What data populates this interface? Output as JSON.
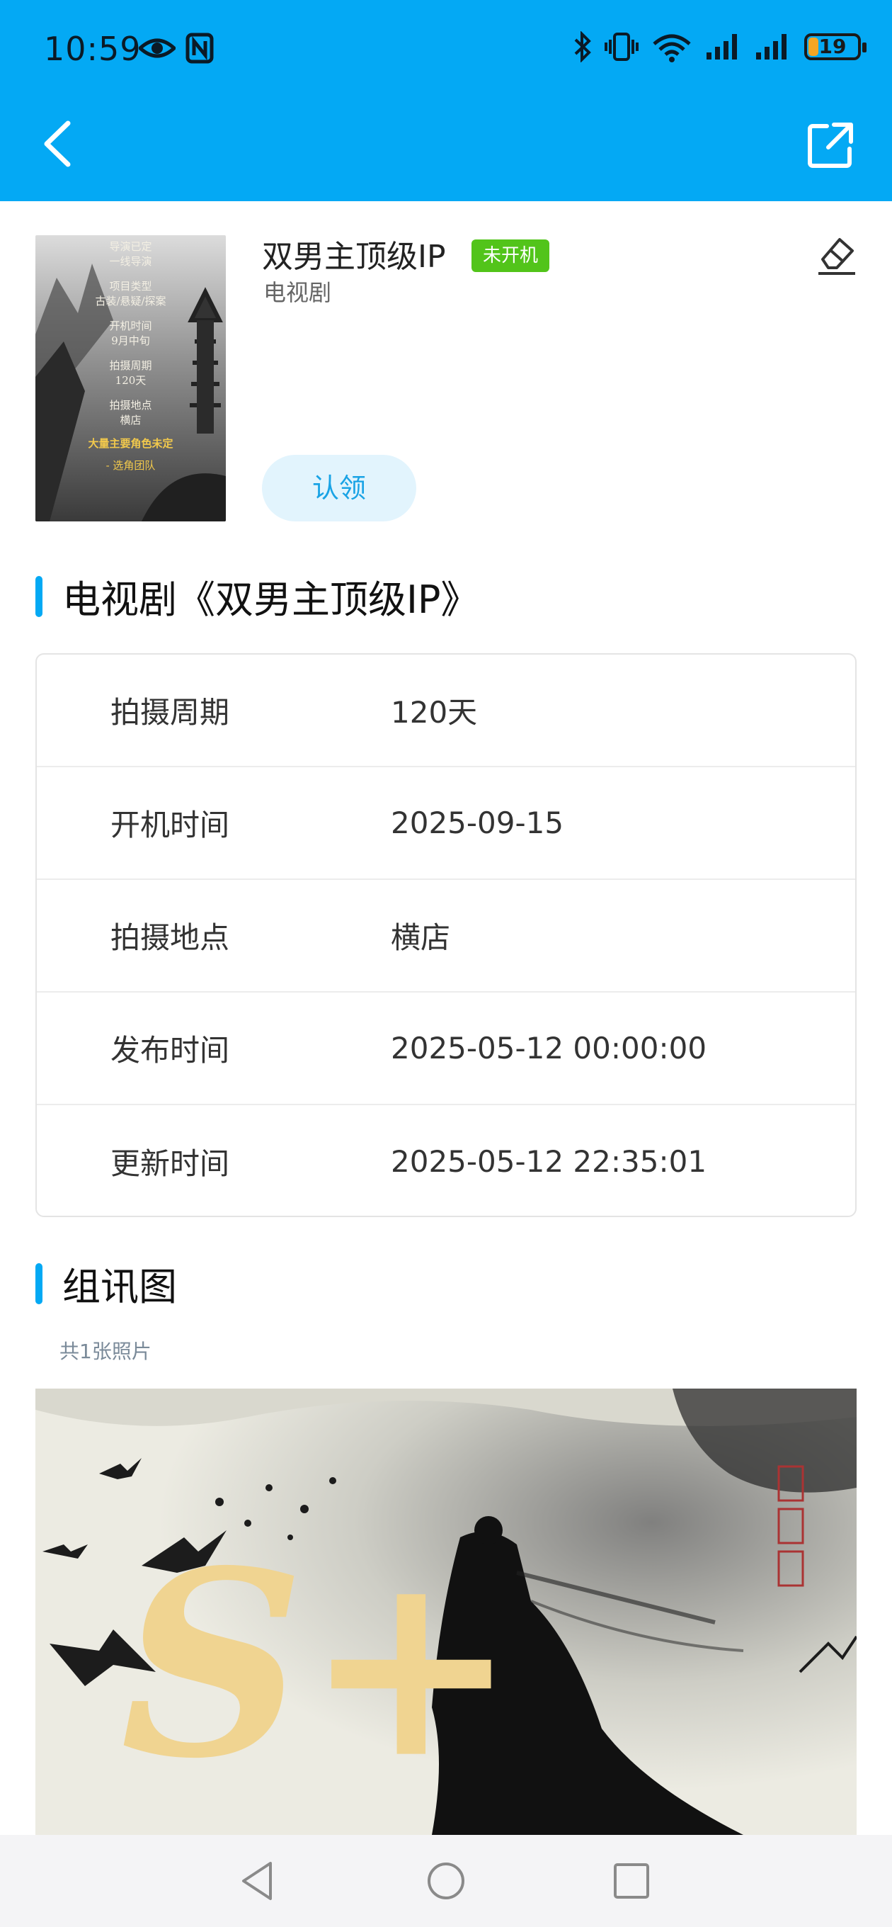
{
  "status_bar": {
    "time": "10:59",
    "battery": "19",
    "battery_level": 0.19,
    "icons": [
      "eye-icon",
      "nfc-icon",
      "bluetooth-icon",
      "vibrate-icon",
      "wifi-icon",
      "signal-icon",
      "signal-icon",
      "battery-icon"
    ]
  },
  "header": {
    "back_icon": "chevron-left-icon",
    "share_icon": "share-external-icon",
    "bar_color": "#04a9f4"
  },
  "project": {
    "title": "双男主顶级IP",
    "status": "未开机",
    "status_color": "#52c41a",
    "type": "电视剧",
    "claim_label": "认领",
    "edit_icon": "eraser-icon",
    "poster_text": [
      "导演已定",
      "一线导演",
      "项目类型",
      "古装/悬疑/探案",
      "开机时间",
      "9月中旬",
      "拍摄周期",
      "120天",
      "拍摄地点",
      "横店",
      "大量主要角色未定",
      "- 选角团队"
    ]
  },
  "info_section": {
    "heading": "电视剧《双男主顶级IP》",
    "rows": [
      {
        "label": "拍摄周期",
        "value": "120天"
      },
      {
        "label": "开机时间",
        "value": "2025-09-15"
      },
      {
        "label": "拍摄地点",
        "value": "横店"
      },
      {
        "label": "发布时间",
        "value": "2025-05-12 00:00:00"
      },
      {
        "label": "更新时间",
        "value": "2025-05-12 22:35:01"
      }
    ]
  },
  "photos_section": {
    "heading": "组讯图",
    "count_text": "共1张照片",
    "image_text": "S+"
  },
  "nav": {
    "icons": [
      "nav-back-icon",
      "nav-home-icon",
      "nav-recents-icon"
    ]
  }
}
